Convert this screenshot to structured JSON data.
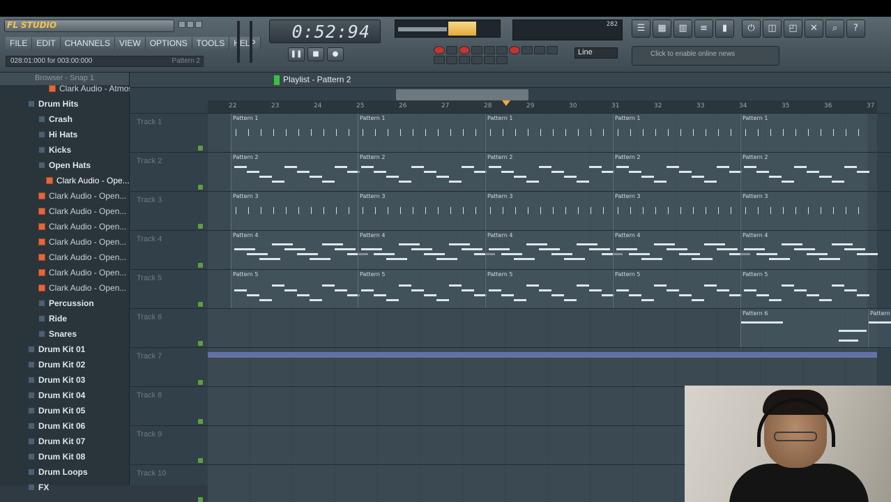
{
  "app": {
    "logo": "FL STUDIO",
    "menu": [
      "FILE",
      "EDIT",
      "CHANNELS",
      "VIEW",
      "OPTIONS",
      "TOOLS",
      "HELP"
    ],
    "hint": "028:01:000 for 003:00:000",
    "hint_pattern": "Pattern 2",
    "time": "0:52:94",
    "monitor": "282",
    "snap_mode": "Line",
    "news": "Click to enable online news"
  },
  "browser": {
    "title": "Browser - Snap 1",
    "items": [
      {
        "label": "Clark Audio - Atmosph...",
        "type": "file"
      },
      {
        "label": "Drum Hits",
        "type": "folder"
      },
      {
        "label": "Crash",
        "type": "folder"
      },
      {
        "label": "Hi Hats",
        "type": "folder"
      },
      {
        "label": "Kicks",
        "type": "folder"
      },
      {
        "label": "Open Hats",
        "type": "folder"
      },
      {
        "label": "Clark Audio - Ope...",
        "type": "file"
      },
      {
        "label": "Clark Audio - Open...",
        "type": "file"
      },
      {
        "label": "Clark Audio - Open...",
        "type": "file"
      },
      {
        "label": "Clark Audio - Open...",
        "type": "file"
      },
      {
        "label": "Clark Audio - Open...",
        "type": "file"
      },
      {
        "label": "Clark Audio - Open...",
        "type": "file"
      },
      {
        "label": "Clark Audio - Open...",
        "type": "file"
      },
      {
        "label": "Clark Audio - Open...",
        "type": "file"
      },
      {
        "label": "Percussion",
        "type": "folder"
      },
      {
        "label": "Ride",
        "type": "folder"
      },
      {
        "label": "Snares",
        "type": "folder"
      },
      {
        "label": "Drum Kit 01",
        "type": "folder"
      },
      {
        "label": "Drum Kit 02",
        "type": "folder"
      },
      {
        "label": "Drum Kit 03",
        "type": "folder"
      },
      {
        "label": "Drum Kit 04",
        "type": "folder"
      },
      {
        "label": "Drum Kit 05",
        "type": "folder"
      },
      {
        "label": "Drum Kit 06",
        "type": "folder"
      },
      {
        "label": "Drum Kit 07",
        "type": "folder"
      },
      {
        "label": "Drum Kit 08",
        "type": "folder"
      },
      {
        "label": "Drum Loops",
        "type": "folder"
      },
      {
        "label": "FX",
        "type": "folder"
      }
    ]
  },
  "playlist": {
    "title": "Playlist - Pattern 2",
    "ruler": [
      "22",
      "23",
      "24",
      "25",
      "26",
      "27",
      "28",
      "29",
      "30",
      "31",
      "32",
      "33",
      "34",
      "35",
      "36",
      "37"
    ],
    "tracks": [
      "Track 1",
      "Track 2",
      "Track 3",
      "Track 4",
      "Track 5",
      "Track 6",
      "Track 7",
      "Track 8",
      "Track 9",
      "Track 10"
    ],
    "patterns": [
      "Pattern 1",
      "Pattern 2",
      "Pattern 3",
      "Pattern 4",
      "Pattern 5",
      "Pattern 6"
    ]
  }
}
